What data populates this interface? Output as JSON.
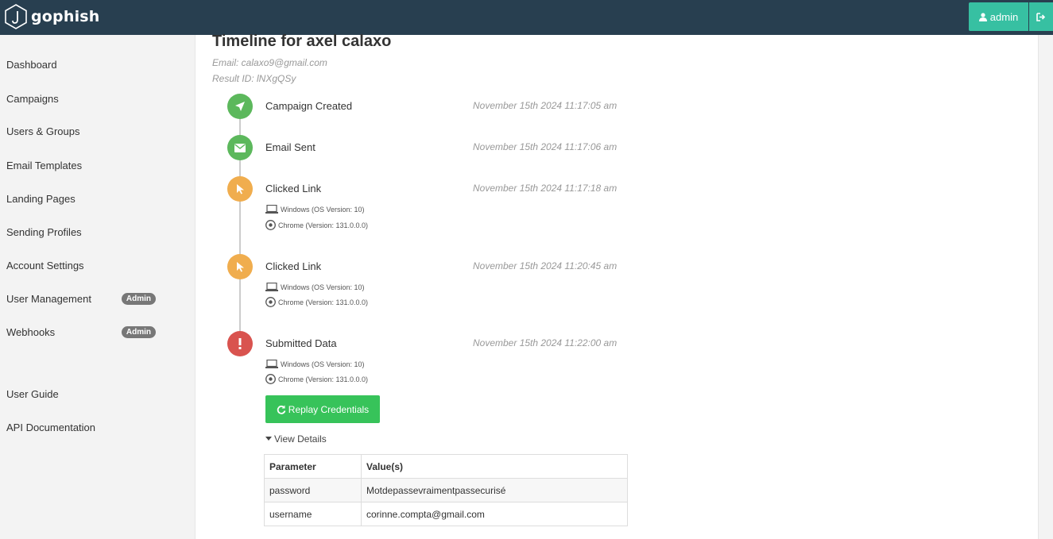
{
  "brand": {
    "name": "gophish"
  },
  "header": {
    "user_label": "admin",
    "user_icon": "user-icon",
    "logout_icon": "sign-out-icon"
  },
  "sidebar": {
    "items": [
      {
        "label": "Dashboard"
      },
      {
        "label": "Campaigns"
      },
      {
        "label": "Users & Groups"
      },
      {
        "label": "Email Templates"
      },
      {
        "label": "Landing Pages"
      },
      {
        "label": "Sending Profiles"
      },
      {
        "label": "Account Settings"
      },
      {
        "label": "User Management",
        "badge": "Admin"
      },
      {
        "label": "Webhooks",
        "badge": "Admin"
      }
    ],
    "secondary": [
      {
        "label": "User Guide"
      },
      {
        "label": "API Documentation"
      }
    ]
  },
  "result": {
    "title": "Timeline for axel calaxo",
    "email": "Email: calaxo9@gmail.com",
    "result_id": "Result ID: lNXgQSy"
  },
  "timeline": [
    {
      "title": "Campaign Created",
      "time": "November 15th 2024 11:17:05 am",
      "status_color": "#5cb85c",
      "icon": "rocket-icon"
    },
    {
      "title": "Email Sent",
      "time": "November 15th 2024 11:17:06 am",
      "status_color": "#5cb85c",
      "icon": "envelope-icon"
    },
    {
      "title": "Clicked Link",
      "time": "November 15th 2024 11:17:18 am",
      "status_color": "#f0ad4e",
      "icon": "pointer-icon",
      "os": "Windows (OS Version: 10)",
      "browser": "Chrome (Version: 131.0.0.0)"
    },
    {
      "title": "Clicked Link",
      "time": "November 15th 2024 11:20:45 am",
      "status_color": "#f0ad4e",
      "icon": "pointer-icon",
      "os": "Windows (OS Version: 10)",
      "browser": "Chrome (Version: 131.0.0.0)"
    },
    {
      "title": "Submitted Data",
      "time": "November 15th 2024 11:22:00 am",
      "status_color": "#d9534f",
      "icon": "exclamation-icon",
      "os": "Windows (OS Version: 10)",
      "browser": "Chrome (Version: 131.0.0.0)"
    }
  ],
  "actions": {
    "replay_label": "Replay Credentials",
    "view_details_label": "View Details"
  },
  "details_table": {
    "headers": [
      "Parameter",
      "Value(s)"
    ],
    "rows": [
      [
        "password",
        "Motdepassevraimentpassecurisé"
      ],
      [
        "username",
        "corinne.compta@gmail.com"
      ]
    ]
  },
  "colors": {
    "navbar": "#283f50",
    "accent": "#37c0a2",
    "success": "#5cb85c",
    "warning": "#f0ad4e",
    "danger": "#d9534f"
  }
}
